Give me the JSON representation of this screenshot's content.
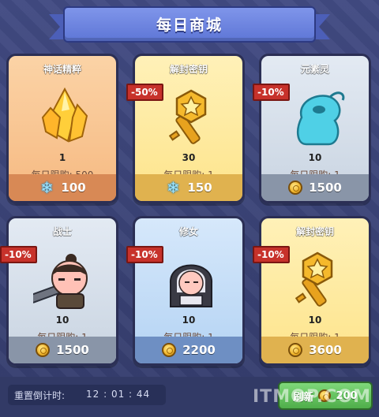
{
  "header": {
    "title": "每日商城"
  },
  "cards": [
    {
      "name": "神话精粹",
      "qty": "1",
      "limit": "每日限购: 500",
      "price": "100",
      "currency": "crystal",
      "discount": "",
      "theme": "orange",
      "icon": "crystal-cluster-icon"
    },
    {
      "name": "解封密钥",
      "qty": "30",
      "limit": "每日限购: 1",
      "price": "150",
      "currency": "crystal",
      "discount": "-50%",
      "theme": "gold",
      "icon": "gold-key-icon"
    },
    {
      "name": "元素灵",
      "qty": "10",
      "limit": "每日限购: 1",
      "price": "1500",
      "currency": "coin",
      "discount": "-10%",
      "theme": "silver",
      "icon": "elemental-spirit-icon"
    },
    {
      "name": "战士",
      "qty": "10",
      "limit": "每日限购: 1",
      "price": "1500",
      "currency": "coin",
      "discount": "-10%",
      "theme": "silver",
      "icon": "warrior-icon"
    },
    {
      "name": "修女",
      "qty": "10",
      "limit": "每日限购: 1",
      "price": "2200",
      "currency": "coin",
      "discount": "-10%",
      "theme": "blue",
      "icon": "nun-icon"
    },
    {
      "name": "解封密钥",
      "qty": "10",
      "limit": "每日限购: 1",
      "price": "3600",
      "currency": "coin",
      "discount": "-10%",
      "theme": "gold",
      "icon": "gold-key-icon"
    }
  ],
  "footer": {
    "timer_label": "重置倒计时:",
    "timer_value": "12 : 01 : 44",
    "refresh_label": "刷新",
    "refresh_cost": "200"
  },
  "watermark": "ITMOP.COM"
}
